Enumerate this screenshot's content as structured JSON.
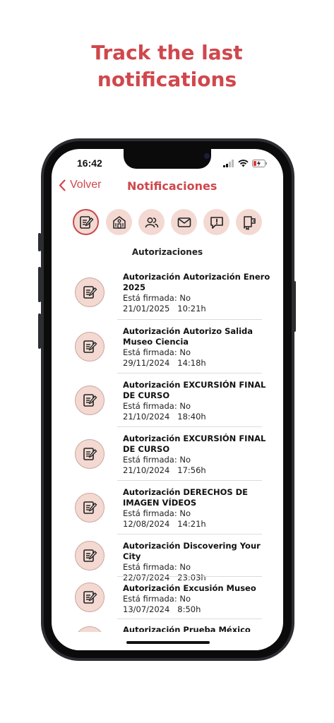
{
  "headline": {
    "line1": "Track the last",
    "line2": "notifications"
  },
  "status_bar": {
    "time": "16:42"
  },
  "nav": {
    "back_label": "Volver",
    "title": "Notificaciones"
  },
  "tabs": [
    {
      "icon": "authorization-icon",
      "active": true
    },
    {
      "icon": "school-icon",
      "active": false
    },
    {
      "icon": "users-icon",
      "active": false
    },
    {
      "icon": "mail-icon",
      "active": false
    },
    {
      "icon": "alert-message-icon",
      "active": false
    },
    {
      "icon": "notebook-icon",
      "active": false
    }
  ],
  "section_title": "Autorizaciones",
  "items": [
    {
      "title": "Autorización Autorización Enero 2025",
      "status": "Está firmada: No",
      "date": "21/01/2025",
      "time": "10:21h"
    },
    {
      "title": "Autorización Autorizo Salida Museo Ciencia",
      "status": "Está firmada: No",
      "date": "29/11/2024",
      "time": "14:18h"
    },
    {
      "title": "Autorización EXCURSIÓN FINAL DE CURSO",
      "status": "Está firmada: No",
      "date": "21/10/2024",
      "time": "18:40h"
    },
    {
      "title": "Autorización EXCURSIÓN FINAL DE CURSO",
      "status": "Está firmada: No",
      "date": "21/10/2024",
      "time": "17:56h"
    },
    {
      "title": "Autorización DERECHOS DE IMAGEN VÍDEOS",
      "status": "Está firmada: No",
      "date": "12/08/2024",
      "time": "14:21h"
    },
    {
      "title": "Autorización Discovering Your City",
      "status": "Está firmada: No",
      "date": "22/07/2024",
      "time": "23:03h"
    },
    {
      "title": "Autorización Excusión Museo",
      "status": "Está firmada: No",
      "date": "13/07/2024",
      "time": "8:50h"
    },
    {
      "title": "Autorización Prueba México",
      "status": "",
      "date": "",
      "time": ""
    }
  ],
  "colors": {
    "accent": "#d0474c",
    "icon_bg": "#f3d9d2"
  }
}
